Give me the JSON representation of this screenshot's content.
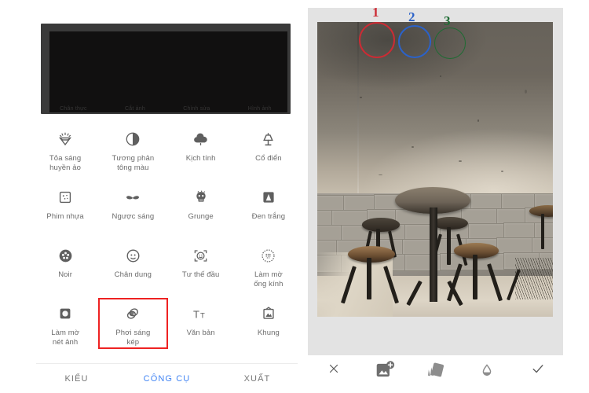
{
  "app": {
    "left_screen_name": "photo-editor-tools-screen",
    "right_screen_name": "double-exposure-editor-screen"
  },
  "preview": {
    "obscured": true,
    "ghost_labels": [
      "Chân thực",
      "Cắt ảnh",
      "Chỉnh sửa",
      "Hình ảnh"
    ]
  },
  "tools": {
    "rows": [
      {
        "items": [
          {
            "label": "Tỏa sáng\nhuyền ảo",
            "icon": "diamond-sparkle-icon",
            "highlighted": false
          },
          {
            "label": "Tương phản\ntông màu",
            "icon": "tonal-contrast-icon",
            "highlighted": false
          },
          {
            "label": "Kịch tính",
            "icon": "rain-cloud-icon",
            "highlighted": false
          },
          {
            "label": "Cổ điển",
            "icon": "lamp-icon",
            "highlighted": false
          }
        ]
      },
      {
        "items": [
          {
            "label": "Phim nhựa",
            "icon": "film-grain-icon",
            "highlighted": false
          },
          {
            "label": "Ngược sáng",
            "icon": "moustache-icon",
            "highlighted": false
          },
          {
            "label": "Grunge",
            "icon": "grunge-skull-icon",
            "highlighted": false
          },
          {
            "label": "Đen trắng",
            "icon": "black-white-icon",
            "highlighted": false
          }
        ]
      },
      {
        "items": [
          {
            "label": "Noir",
            "icon": "film-reel-icon",
            "highlighted": false
          },
          {
            "label": "Chân dung",
            "icon": "portrait-face-icon",
            "highlighted": false
          },
          {
            "label": "Tư thế đầu",
            "icon": "head-pose-icon",
            "highlighted": false
          },
          {
            "label": "Làm mờ\nống kính",
            "icon": "lens-blur-icon",
            "highlighted": false
          }
        ]
      },
      {
        "items": [
          {
            "label": "Làm mờ\nnét ảnh",
            "icon": "tilt-shift-icon",
            "highlighted": false
          },
          {
            "label": "Phơi sáng\nkép",
            "icon": "double-exposure-icon",
            "highlighted": true
          },
          {
            "label": "Văn bản",
            "icon": "text-icon",
            "highlighted": false
          },
          {
            "label": "Khung",
            "icon": "frame-icon",
            "highlighted": false
          }
        ]
      }
    ]
  },
  "tabs": [
    {
      "label": "KIỂU",
      "active": false
    },
    {
      "label": "CÔNG CỤ",
      "active": true
    },
    {
      "label": "XUẤT",
      "active": false
    }
  ],
  "editor_bar": {
    "cancel": {
      "icon": "close-x-icon"
    },
    "confirm": {
      "icon": "check-icon"
    },
    "buttons": [
      {
        "icon": "add-image-icon",
        "annotation": "1",
        "annotation_color": "#cc2b34"
      },
      {
        "icon": "blend-mode-icon",
        "annotation": "2",
        "annotation_color": "#2b62c9"
      },
      {
        "icon": "opacity-droplet-icon",
        "annotation": "3",
        "annotation_color": "#1e6b33"
      }
    ]
  },
  "photo": {
    "description": "Cafe interior: round wooden table with metal stools against a stone brick wall",
    "alt_name": "edited-photo-preview"
  },
  "colors": {
    "accent_blue": "#4285f4",
    "highlight_red": "#ee2222",
    "label_gray": "#6b6b6b",
    "panel_gray": "#e3e3e3"
  }
}
